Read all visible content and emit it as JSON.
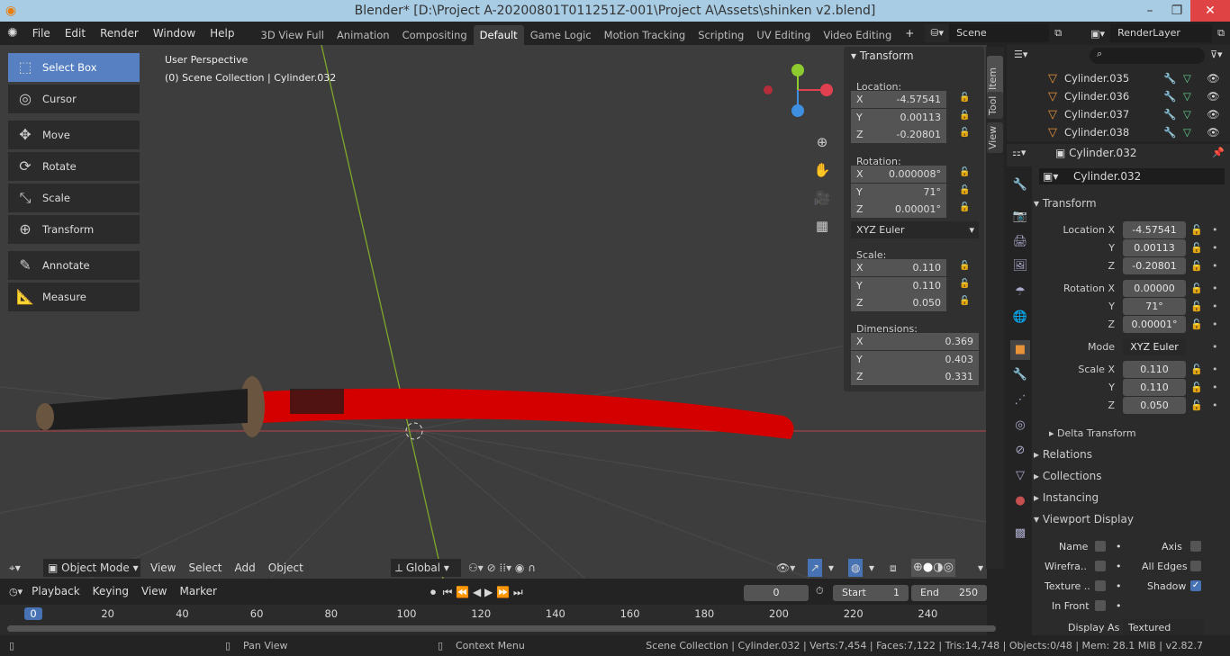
{
  "window": {
    "title": "Blender* [D:\\Project A-20200801T011251Z-001\\Project A\\Assets\\shinken v2.blend]",
    "controls": [
      "–",
      "❐",
      "✕"
    ]
  },
  "menu": [
    "File",
    "Edit",
    "Render",
    "Window",
    "Help"
  ],
  "workspaces": [
    "3D View Full",
    "Animation",
    "Compositing",
    "Default",
    "Game Logic",
    "Motion Tracking",
    "Scripting",
    "UV Editing",
    "Video Editing"
  ],
  "active_workspace": "Default",
  "scene": {
    "name": "Scene",
    "layer": "RenderLayer",
    "add": "+"
  },
  "viewport": {
    "perspective": "User Perspective",
    "collection": "(0) Scene Collection | Cylinder.032",
    "tools": [
      {
        "label": "Select Box",
        "icon": "select-box-icon",
        "glyph": "⬚"
      },
      {
        "label": "Cursor",
        "icon": "cursor-icon",
        "glyph": "◎"
      },
      {
        "label": "Move",
        "icon": "move-icon",
        "glyph": "✥"
      },
      {
        "label": "Rotate",
        "icon": "rotate-icon",
        "glyph": "⟳"
      },
      {
        "label": "Scale",
        "icon": "scale-icon",
        "glyph": "⤡"
      },
      {
        "label": "Transform",
        "icon": "transform-icon",
        "glyph": "⊕"
      },
      {
        "label": "Annotate",
        "icon": "annotate-icon",
        "glyph": "✎"
      },
      {
        "label": "Measure",
        "icon": "measure-icon",
        "glyph": "📐"
      }
    ],
    "header": {
      "mode": "Object Mode",
      "menus": [
        "View",
        "Select",
        "Add",
        "Object"
      ],
      "orientation": "Global"
    },
    "gizmo": {
      "x": "X",
      "y": "Y",
      "z": "Z"
    },
    "colors": {
      "blade": "#d40000",
      "background": "#3d3d3d",
      "x_axis": "#e04050",
      "y_axis": "#8ecb30",
      "z_axis": "#3f8fe0"
    }
  },
  "sidebar": {
    "tabs": [
      "Item",
      "Tool",
      "View"
    ],
    "panel_title": "Transform",
    "location_label": "Location:",
    "location": [
      [
        "X",
        "-4.57541"
      ],
      [
        "Y",
        "0.00113"
      ],
      [
        "Z",
        "-0.20801"
      ]
    ],
    "rotation_label": "Rotation:",
    "rotation": [
      [
        "X",
        "0.000008°"
      ],
      [
        "Y",
        "71°"
      ],
      [
        "Z",
        "0.00001°"
      ]
    ],
    "rotation_mode": "XYZ Euler",
    "scale_label": "Scale:",
    "scale": [
      [
        "X",
        "0.110"
      ],
      [
        "Y",
        "0.110"
      ],
      [
        "Z",
        "0.050"
      ]
    ],
    "dimensions_label": "Dimensions:",
    "dimensions": [
      [
        "X",
        "0.369"
      ],
      [
        "Y",
        "0.403"
      ],
      [
        "Z",
        "0.331"
      ]
    ]
  },
  "outliner": {
    "items": [
      "Cylinder.035",
      "Cylinder.036",
      "Cylinder.037",
      "Cylinder.038"
    ]
  },
  "properties": {
    "object": "Cylinder.032",
    "object_name_field": "Cylinder.032",
    "transform_title": "Transform",
    "rows": [
      [
        "Location X",
        "-4.57541"
      ],
      [
        "Y",
        "0.00113"
      ],
      [
        "Z",
        "-0.20801"
      ],
      [
        "Rotation X",
        "0.00000"
      ],
      [
        "Y",
        "71°"
      ],
      [
        "Z",
        "0.00001°"
      ],
      [
        "Mode",
        "XYZ Euler"
      ],
      [
        "Scale X",
        "0.110"
      ],
      [
        "Y",
        "0.110"
      ],
      [
        "Z",
        "0.050"
      ]
    ],
    "sections": [
      "Delta Transform",
      "Relations",
      "Collections",
      "Instancing",
      "Viewport Display"
    ],
    "viewport_display": {
      "name": "Name",
      "axis": "Axis",
      "wireframe": "Wirefra..",
      "all_edges": "All Edges",
      "texture": "Texture ..",
      "shadow": "Shadow",
      "shadow_checked": true,
      "in_front": "In Front",
      "display_as_label": "Display As",
      "display_as": "Textured"
    }
  },
  "timeline": {
    "menus": [
      "Playback",
      "Keying",
      "View",
      "Marker"
    ],
    "current_frame": "0",
    "start_label": "Start",
    "start": "1",
    "end_label": "End",
    "end": "250",
    "ticks": [
      "0",
      "20",
      "40",
      "60",
      "80",
      "100",
      "120",
      "140",
      "160",
      "180",
      "200",
      "220",
      "240"
    ]
  },
  "status": {
    "pan": "Pan View",
    "context": "Context Menu",
    "info": "Scene Collection | Cylinder.032 | Verts:7,454 | Faces:7,122 | Tris:14,748 | Objects:0/48 | Mem: 28.1 MiB | v2.82.7"
  }
}
